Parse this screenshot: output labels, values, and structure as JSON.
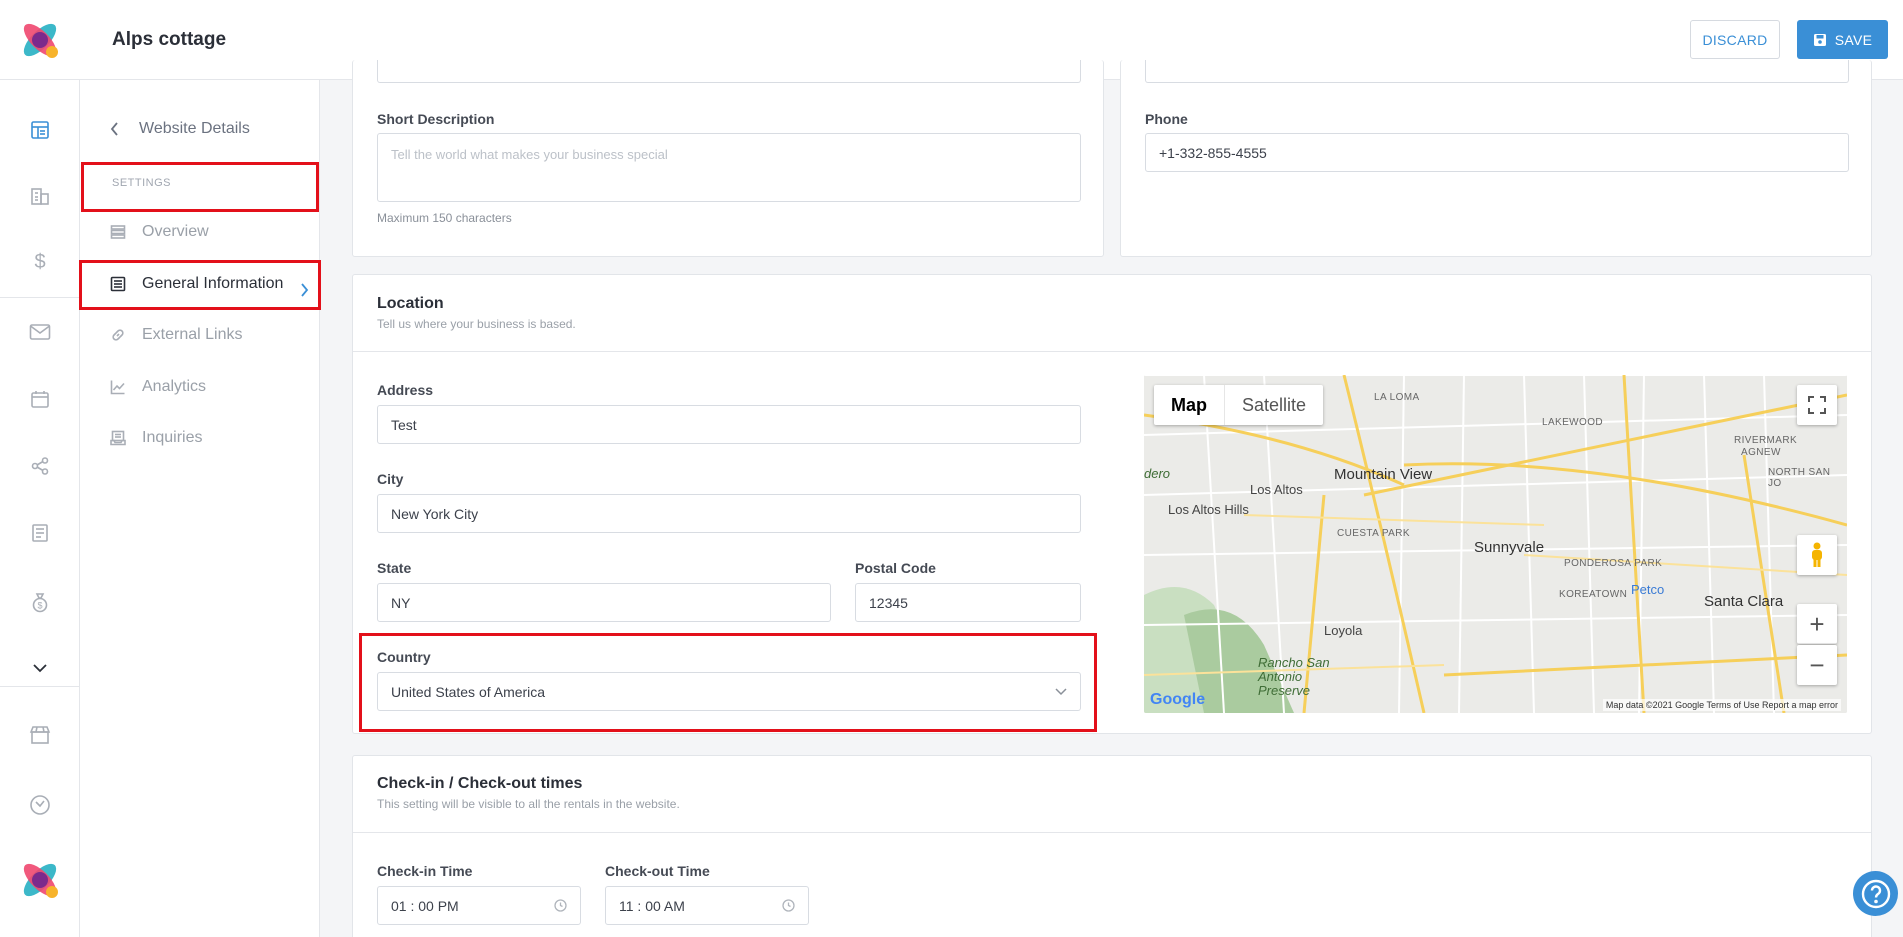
{
  "header": {
    "title": "Alps cottage",
    "discard_label": "DISCARD",
    "save_label": "SAVE"
  },
  "sidebar": {
    "back_label": "Website Details",
    "section_label": "SETTINGS",
    "items": [
      {
        "label": "Overview",
        "icon": "layers-icon"
      },
      {
        "label": "General Information",
        "icon": "list-icon"
      },
      {
        "label": "External Links",
        "icon": "link-icon"
      },
      {
        "label": "Analytics",
        "icon": "chart-icon"
      },
      {
        "label": "Inquiries",
        "icon": "inbox-icon"
      }
    ]
  },
  "general": {
    "short_description_label": "Short Description",
    "short_description_placeholder": "Tell the world what makes your business special",
    "short_description_helper": "Maximum 150 characters",
    "phone_label": "Phone",
    "phone_value": "+1-332-855-4555"
  },
  "location": {
    "title": "Location",
    "subtitle": "Tell us where your business is based.",
    "address_label": "Address",
    "address_value": "Test",
    "city_label": "City",
    "city_value": "New York City",
    "state_label": "State",
    "state_value": "NY",
    "postal_label": "Postal Code",
    "postal_value": "12345",
    "country_label": "Country",
    "country_value": "United States of America"
  },
  "map": {
    "tab_map": "Map",
    "tab_satellite": "Satellite",
    "labels": [
      "Mountain View",
      "Los Altos",
      "Los Altos Hills",
      "Sunnyvale",
      "Santa Clara",
      "Loyola",
      "Rancho San Antonio Preserve",
      "Petco",
      "LAKEWOOD",
      "RIVERMARK",
      "AGNEW",
      "NORTH SAN JO",
      "CUESTA PARK",
      "PONDEROSA PARK",
      "KOREATOWN",
      "LA LOMA",
      "dero",
      "Google"
    ],
    "footer": "Map data ©2021 Google   Terms of Use   Report a map error"
  },
  "checkin": {
    "title": "Check-in / Check-out times",
    "subtitle": "This setting will be visible to all the rentals in the website.",
    "checkin_label": "Check-in Time",
    "checkin_value": "01 : 00 PM",
    "checkout_label": "Check-out Time",
    "checkout_value": "11 : 00 AM"
  },
  "colors": {
    "accent": "#3a8fd6",
    "highlight": "#e3101a"
  }
}
